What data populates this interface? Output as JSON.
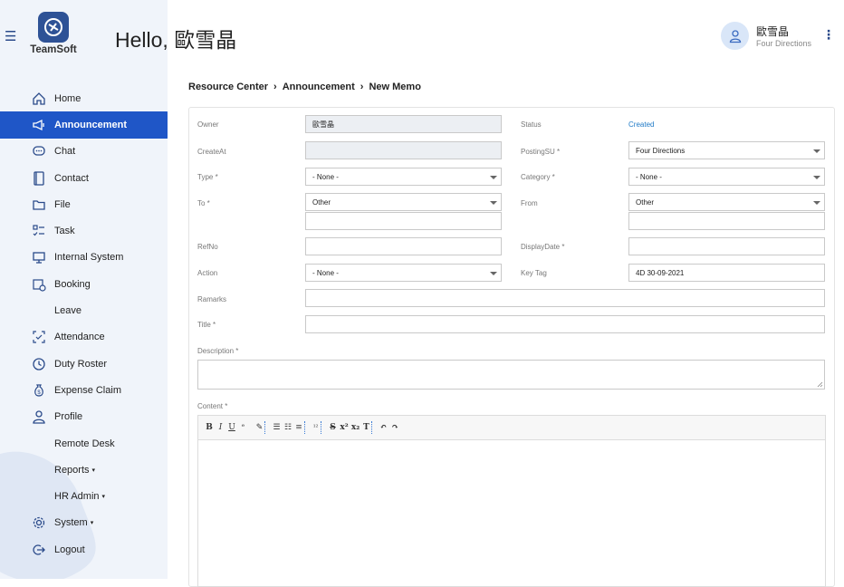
{
  "app": {
    "name": "TeamSoft",
    "greeting": "Hello, 歐雪晶"
  },
  "user": {
    "name": "歐雪晶",
    "org": "Four Directions"
  },
  "breadcrumb": [
    "Resource Center",
    "Announcement",
    "New Memo"
  ],
  "sidebar": {
    "items": [
      {
        "label": "Home",
        "icon": "home-icon"
      },
      {
        "label": "Announcement",
        "icon": "megaphone-icon",
        "active": true
      },
      {
        "label": "Chat",
        "icon": "chat-icon"
      },
      {
        "label": "Contact",
        "icon": "contact-book-icon"
      },
      {
        "label": "File",
        "icon": "folder-icon"
      },
      {
        "label": "Task",
        "icon": "checklist-icon"
      },
      {
        "label": "Internal System",
        "icon": "monitor-icon"
      },
      {
        "label": "Booking",
        "icon": "calendar-clock-icon"
      },
      {
        "label": "Leave",
        "icon": ""
      },
      {
        "label": "Attendance",
        "icon": "attendance-icon"
      },
      {
        "label": "Duty Roster",
        "icon": "clock-icon"
      },
      {
        "label": "Expense Claim",
        "icon": "money-bag-icon"
      },
      {
        "label": "Profile",
        "icon": "person-icon"
      },
      {
        "label": "Remote Desk",
        "icon": ""
      },
      {
        "label": "Reports",
        "icon": "",
        "caret": "▾"
      },
      {
        "label": "HR Admin",
        "icon": "",
        "caret": "▾"
      },
      {
        "label": "System",
        "icon": "gear-icon",
        "caret": "▾"
      },
      {
        "label": "Logout",
        "icon": "logout-icon"
      }
    ]
  },
  "form": {
    "owner_label": "Owner",
    "owner_value": "歐雪晶",
    "status_label": "Status",
    "status_value": "Created",
    "createat_label": "CreateAt",
    "createat_value": "",
    "postingsu_label": "PostingSU *",
    "postingsu_value": "Four Directions",
    "type_label": "Type *",
    "type_value": "- None -",
    "category_label": "Category *",
    "category_value": "- None -",
    "to_label": "To *",
    "to_value": "Other",
    "to_other_value": "",
    "from_label": "From",
    "from_value": "Other",
    "from_other_value": "",
    "refno_label": "RefNo",
    "refno_value": "",
    "displaydate_label": "DisplayDate *",
    "displaydate_value": "",
    "action_label": "Action",
    "action_value": "- None -",
    "keytag_label": "Key Tag",
    "keytag_value": "4D 30-09-2021",
    "remarks_label": "Ramarks",
    "remarks_value": "",
    "title_label": "Title *",
    "title_value": "",
    "description_label": "Description *",
    "description_value": "",
    "content_label": "Content *"
  },
  "editor_toolbar": [
    "B",
    "I",
    "U",
    "ᵉ",
    "✎",
    "☰",
    "☷",
    "≡",
    "¹²",
    "S",
    "x²",
    "x₂",
    "T",
    "↶",
    "↷"
  ],
  "colors": {
    "accent": "#1f56c7",
    "sidebar_bg": "#f0f4fa",
    "status": "#1f7ac7"
  }
}
